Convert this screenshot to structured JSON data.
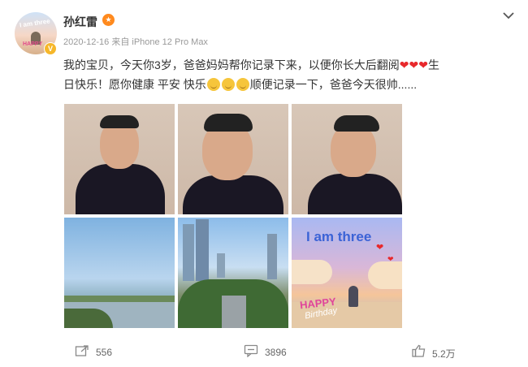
{
  "user": {
    "name": "孙红雷",
    "avatar_text": "I am three",
    "avatar_badge": "HAPPY"
  },
  "post": {
    "meta": "2020-12-16  来自 iPhone 12 Pro Max",
    "text_part1": "我的宝贝，今天你3岁，爸爸妈妈帮你记录下来，以便你长大后翻阅",
    "text_part2": "生日快乐！愿你健康 平安 快乐",
    "text_part3": "顺便记录一下，爸爸今天很帅......",
    "photo6_title": "I am three",
    "photo6_happy": "HAPPY",
    "photo6_birthday": "Birthday"
  },
  "actions": {
    "share_count": "556",
    "comment_count": "3896",
    "like_count": "5.2万"
  },
  "colors": {
    "accent": "#ff8a1e",
    "heart": "#e8282b",
    "meta": "#999999"
  }
}
